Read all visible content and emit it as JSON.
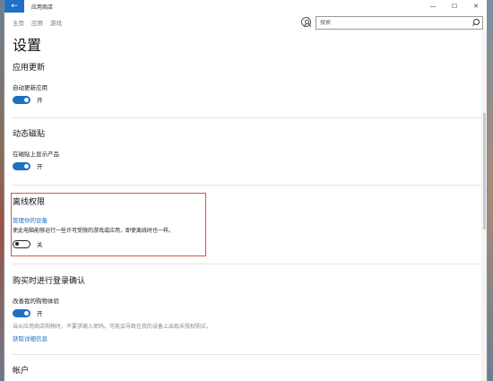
{
  "window": {
    "app_title": "应用商店",
    "back_icon": "back-arrow-icon",
    "controls": {
      "minimize": "—",
      "maximize": "☐",
      "close": "✕"
    }
  },
  "nav": {
    "tabs": [
      "主页",
      "应用",
      "游戏"
    ],
    "search_placeholder": "搜索"
  },
  "page": {
    "title": "设置",
    "sections": {
      "app_updates": {
        "title": "应用更新",
        "setting_label": "自动更新应用",
        "toggle_state": "开",
        "toggle_on": true
      },
      "live_tile": {
        "title": "动态磁贴",
        "setting_label": "在磁贴上显示产品",
        "toggle_state": "开",
        "toggle_on": true
      },
      "offline": {
        "title": "离线权限",
        "link": "管理你的设备",
        "description": "使此电脑能够运行一些许可受限的游戏或应用，即使离线时也一样。",
        "toggle_state": "关",
        "toggle_on": false
      },
      "purchase": {
        "title": "购买时进行登录确认",
        "setting_label": "改善我的购物体验",
        "toggle_state": "开",
        "toggle_on": true,
        "description": "当从应用商店购物时，不要求输入密码。可能会导致在我的设备上出现未授权购买。",
        "link": "获取详细信息"
      },
      "account": {
        "title": "帐户"
      }
    }
  },
  "colors": {
    "accent": "#1f6fc5",
    "highlight_border": "#d9534f"
  }
}
